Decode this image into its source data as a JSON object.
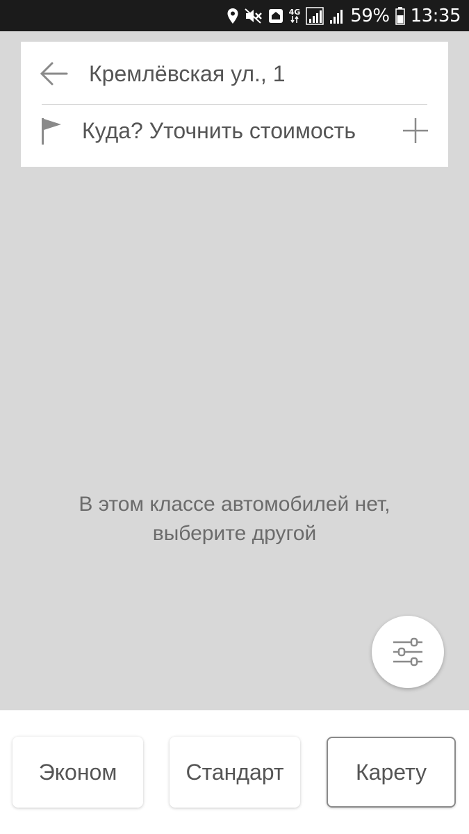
{
  "status_bar": {
    "network_label": "4G",
    "battery_percent": "59%",
    "time": "13:35"
  },
  "route": {
    "from_address": "Кремлёвская ул., 1",
    "to_placeholder": "Куда? Уточнить стоимость"
  },
  "empty_state": {
    "line1": "В этом классе автомобилей нет,",
    "line2": "выберите другой"
  },
  "car_classes": [
    {
      "label": "Эконом",
      "selected": false
    },
    {
      "label": "Стандарт",
      "selected": false
    },
    {
      "label": "Карету",
      "selected": true
    }
  ],
  "icons": {
    "back": "arrow-left-icon",
    "flag": "flag-icon",
    "add": "plus-icon",
    "filter": "sliders-icon"
  },
  "colors": {
    "map_background": "#d8d8d8",
    "status_bar": "#1b1b1b",
    "text_primary": "#555555",
    "selected_border": "#8a8a8a"
  }
}
